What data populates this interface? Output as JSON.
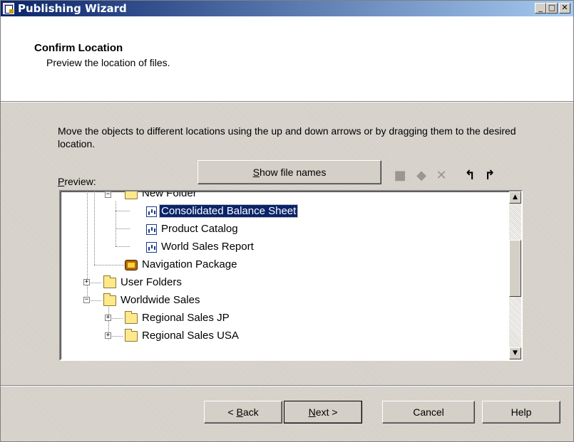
{
  "window": {
    "title": "Publishing Wizard",
    "controls": {
      "minimize": "_",
      "maximize": "□",
      "close": "✕"
    }
  },
  "header": {
    "title": "Confirm Location",
    "subtitle": "Preview the location of files."
  },
  "body": {
    "instruction": "Move the objects to different locations using the up and down arrows or by dragging them to the desired location.",
    "preview_label": {
      "mnemonic": "P",
      "rest": "review:"
    },
    "show_file_names": {
      "mnemonic": "S",
      "rest": "how file names"
    },
    "toolbar_icons": [
      "new-folder-icon",
      "new-package-icon",
      "delete-icon",
      "move-up-icon",
      "move-to-parent-icon"
    ]
  },
  "tree": {
    "items": [
      {
        "label": "New Folder",
        "icon": "folder",
        "expander": "−"
      },
      {
        "label": "Consolidated Balance Sheet",
        "icon": "report",
        "selected": true
      },
      {
        "label": "Product Catalog",
        "icon": "report"
      },
      {
        "label": "World Sales Report",
        "icon": "report"
      },
      {
        "label": "Navigation Package",
        "icon": "package"
      },
      {
        "label": "User Folders",
        "icon": "folder",
        "expander": "+"
      },
      {
        "label": "Worldwide Sales",
        "icon": "folder",
        "expander": "−"
      },
      {
        "label": "Regional Sales JP",
        "icon": "folder",
        "expander": "+"
      },
      {
        "label": "Regional Sales USA",
        "icon": "folder",
        "expander": "+"
      }
    ]
  },
  "footer": {
    "back": {
      "prefix": "< ",
      "mnemonic": "B",
      "rest": "ack"
    },
    "next": {
      "mnemonic": "N",
      "rest": "ext >"
    },
    "cancel": "Cancel",
    "help": "Help"
  }
}
